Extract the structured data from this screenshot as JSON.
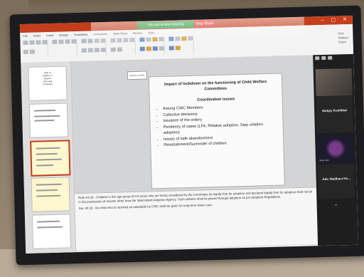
{
  "share_bar": {
    "left_text": "You are screen sharing",
    "right_text": "Stop Share"
  },
  "window_controls": "– ▢ ✕",
  "ribbon": {
    "tabs": [
      "File",
      "Home",
      "Insert",
      "Design",
      "Transitions",
      "Animations",
      "Slide Show",
      "Review",
      "View"
    ],
    "right_items": [
      "Find",
      "Replace",
      "Select"
    ]
  },
  "thumbnails": [
    {
      "lines": [
        "Role of",
        "Children in",
        "Need of",
        "Care and",
        "Protection"
      ]
    }
  ],
  "small_box": "Impact on CWC",
  "slide": {
    "title": "Impact of lockdown on the functioning of Child Welfare Committees",
    "subtitle": "Coordination issues",
    "bullets": [
      "Among CWC Members",
      "Collective decisions",
      "Issuance of the orders",
      "Pendency of cases (LFA, Relative adoption, Step children adoption)",
      "Issues of safe abandonment",
      "Reinstatement/Surrender of children"
    ]
  },
  "notes": [
    "Rule 44 (2) - Children in the age group of 0-6 years who are being considered by the Committee as legally free for adoption and declared legally free for adoption shall not be in the possession of anyone other than the Specialised Adoption Agency. Such children shall be placed through adoption as per Adoption Regulations.",
    "Sec 38 (3) - No child who is reported as adoptable by CWC shall be given for long-term foster care."
  ],
  "participants": [
    {
      "name": "Sanjay Kumbhar",
      "small": ""
    },
    {
      "name": "",
      "small": "Jairaj Sahi"
    },
    {
      "name": "Adv. Madhavi Kh...",
      "small": ""
    }
  ]
}
